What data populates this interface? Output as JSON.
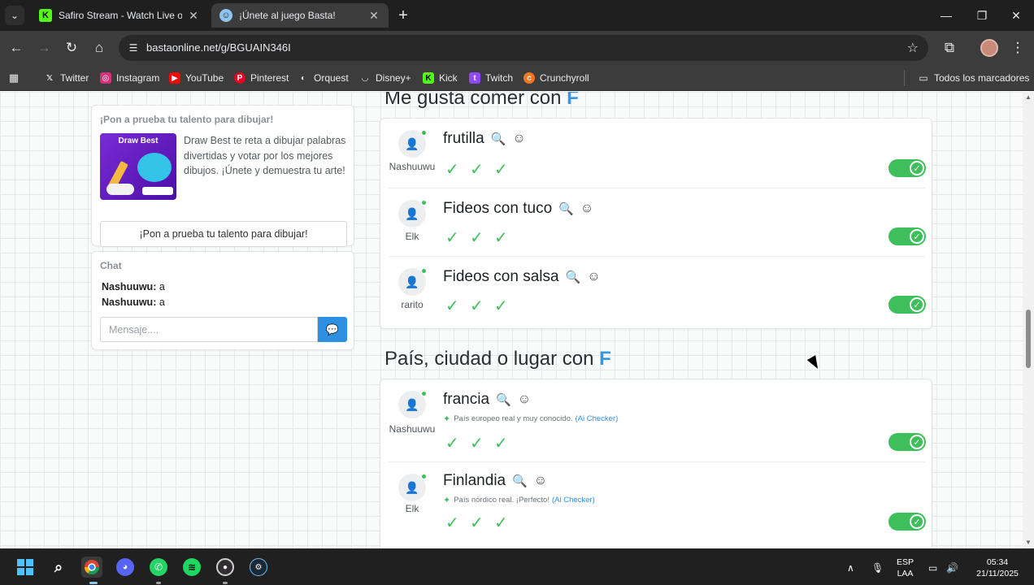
{
  "browser": {
    "tabs": [
      {
        "title": "Safiro Stream - Watch Live on K",
        "icon": "kick-icon",
        "active": false
      },
      {
        "title": "¡Únete al juego Basta!",
        "icon": "basta-icon",
        "active": true
      }
    ],
    "url": "bastaonline.net/g/BGUAIN346I",
    "bookmarks": [
      {
        "label": "Twitter",
        "icon": "x-icon"
      },
      {
        "label": "Instagram",
        "icon": "instagram-icon"
      },
      {
        "label": "YouTube",
        "icon": "youtube-icon"
      },
      {
        "label": "Pinterest",
        "icon": "pinterest-icon"
      },
      {
        "label": "Orquest",
        "icon": "orquest-icon"
      },
      {
        "label": "Disney+",
        "icon": "disney-icon"
      },
      {
        "label": "Kick",
        "icon": "kick-icon"
      },
      {
        "label": "Twitch",
        "icon": "twitch-icon"
      },
      {
        "label": "Crunchyroll",
        "icon": "crunchyroll-icon"
      }
    ],
    "all_bookmarks": "Todos los marcadores"
  },
  "promo": {
    "heading": "¡Pon a prueba tu talento para dibujar!",
    "image_label": "Draw Best",
    "text": "Draw Best te reta a dibujar palabras divertidas y votar por los mejores dibujos. ¡Únete y demuestra tu arte!",
    "cta": "¡Pon a prueba tu talento para dibujar!"
  },
  "chat": {
    "heading": "Chat",
    "messages": [
      {
        "user": "Nashuuwu:",
        "text": "a"
      },
      {
        "user": "Nashuuwu:",
        "text": "a"
      }
    ],
    "placeholder": "Mensaje...."
  },
  "sections": [
    {
      "title": "Me gusta comer con",
      "letter": "F",
      "answers": [
        {
          "user": "Nashuuwu",
          "word": "frutilla",
          "ai_note": "",
          "ai_checker": "",
          "votes": 3,
          "valid": true
        },
        {
          "user": "Elk",
          "word": "Fideos con tuco",
          "ai_note": "",
          "ai_checker": "",
          "votes": 3,
          "valid": true
        },
        {
          "user": "rarito",
          "word": "Fideos con salsa",
          "ai_note": "",
          "ai_checker": "",
          "votes": 3,
          "valid": true
        }
      ]
    },
    {
      "title": "País, ciudad o lugar con",
      "letter": "F",
      "answers": [
        {
          "user": "Nashuuwu",
          "word": "francia",
          "ai_note": "País europeo real y muy conocido.",
          "ai_checker": "(Ai Checker)",
          "votes": 3,
          "valid": true
        },
        {
          "user": "Elk",
          "word": "Finlandia",
          "ai_note": "País nórdico real. ¡Perfecto!",
          "ai_checker": "(Ai Checker)",
          "votes": 3,
          "valid": true
        }
      ]
    }
  ],
  "taskbar": {
    "lang_top": "ESP",
    "lang_bottom": "LAA",
    "time": "05:34",
    "date": "21/11/2025"
  },
  "colors": {
    "accent_blue": "#3399e6",
    "valid_green": "#3fbf5b"
  }
}
